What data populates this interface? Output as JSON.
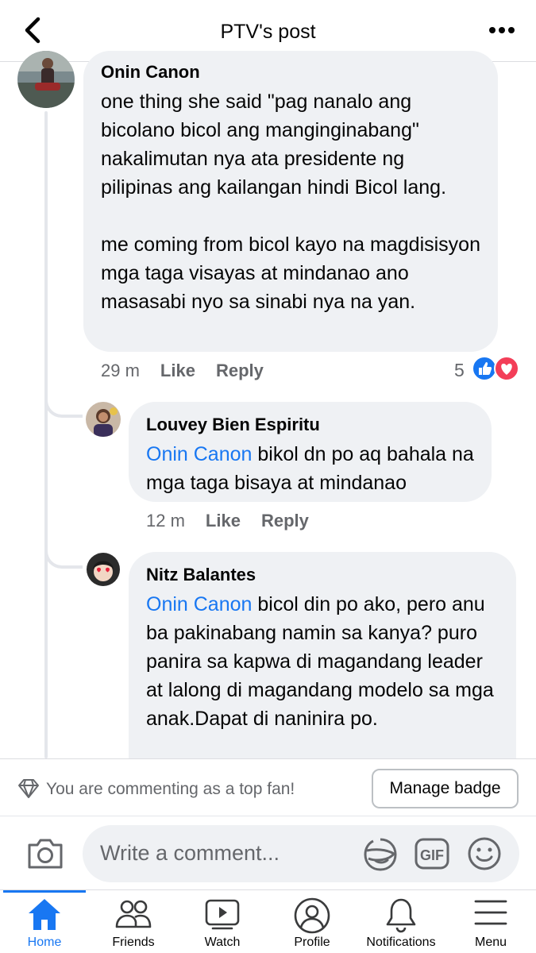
{
  "header": {
    "title": "PTV's post"
  },
  "comments": [
    {
      "author": "Onin Canon",
      "text": "one thing she said \"pag nanalo ang bicolano bicol ang manginginabang\" nakalimutan nya ata presidente ng pilipinas ang kailangan hindi Bicol lang.\n\nme coming from bicol kayo na magdisisyon mga taga visayas at mindanao ano masasabi nyo sa sinabi nya na yan.",
      "time": "29 m",
      "like": "Like",
      "reply": "Reply",
      "reaction_count": "5",
      "reactions": [
        "like-reaction-icon",
        "love-reaction-icon"
      ]
    }
  ],
  "replies": [
    {
      "author": "Louvey Bien Espiritu",
      "mention": "Onin Canon",
      "text": " bikol dn po aq bahala na mga taga bisaya at mindanao",
      "time": "12 m",
      "like": "Like",
      "reply": "Reply"
    },
    {
      "author": "Nitz Balantes",
      "mention": "Onin Canon",
      "text": " bicol din po ako, pero anu ba pakinabang namin sa kanya? puro panira sa kapwa di magandang leader at lalong di magandang modelo sa mga anak.Dapat di naninira po."
    }
  ],
  "fan_bar": {
    "text": "You are commenting as a top fan!",
    "button": "Manage badge"
  },
  "composer": {
    "placeholder": "Write a comment...",
    "icons": [
      "camera-icon",
      "sticker-icon",
      "gif-icon",
      "emoji-icon"
    ]
  },
  "nav": {
    "items": [
      {
        "label": "Home",
        "icon": "home-icon",
        "active": true
      },
      {
        "label": "Friends",
        "icon": "friends-icon",
        "active": false
      },
      {
        "label": "Watch",
        "icon": "watch-icon",
        "active": false
      },
      {
        "label": "Profile",
        "icon": "profile-icon",
        "active": false
      },
      {
        "label": "Notifications",
        "icon": "bell-icon",
        "active": false
      },
      {
        "label": "Menu",
        "icon": "menu-icon",
        "active": false
      }
    ]
  },
  "colors": {
    "accent": "#1877f2",
    "bubble": "#eff1f4",
    "muted": "#65676b",
    "love": "#f33e58"
  }
}
